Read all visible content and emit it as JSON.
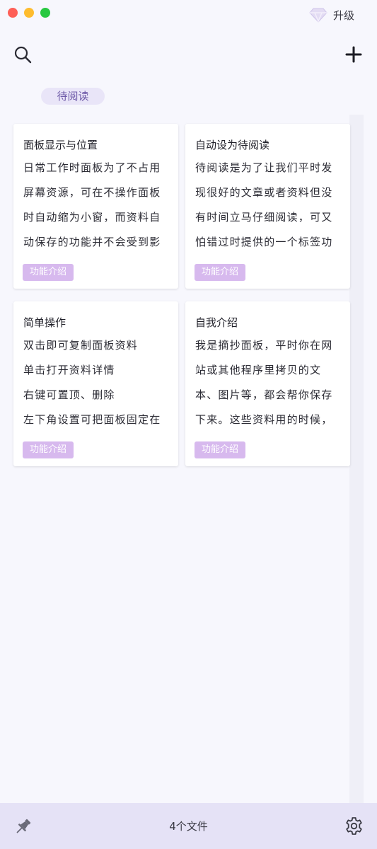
{
  "window": {
    "controls": [
      "close",
      "minimize",
      "zoom"
    ]
  },
  "header": {
    "upgrade": {
      "icon": "diamond-icon",
      "label": "升级"
    },
    "search_icon": "search-icon",
    "add_icon": "plus-icon",
    "tabs": [
      "",
      "",
      "",
      "",
      ""
    ]
  },
  "filter": {
    "active_label": "待阅读"
  },
  "cards": [
    {
      "title": "面板显示与位置",
      "lines": [
        "日常工作时面板为了不占用",
        "屏幕资源，可在不操作面板",
        "时自动缩为小窗，而资料自",
        "动保存的功能并不会受到影"
      ],
      "tag": "功能介绍"
    },
    {
      "title": "自动设为待阅读",
      "lines": [
        "待阅读是为了让我们平时发",
        "现很好的文章或者资料但没",
        "有时间立马仔细阅读，可又",
        "怕错过时提供的一个标签功"
      ],
      "tag": "功能介绍"
    },
    {
      "title": "简单操作",
      "lines": [
        "双击即可复制面板资料",
        "单击打开资料详情",
        "右键可置顶、删除",
        "左下角设置可把面板固定在"
      ],
      "tag": "功能介绍"
    },
    {
      "title": "自我介绍",
      "lines": [
        "我是摘抄面板，平时你在网",
        "站或其他程序里拷贝的文",
        "本、图片等，都会帮你保存",
        "下来。这些资料用的时候，"
      ],
      "tag": "功能介绍"
    }
  ],
  "footer": {
    "pin_icon": "pin-icon",
    "file_count": "4个文件",
    "settings_icon": "gear-icon"
  },
  "colors": {
    "background": "#f7f7fd",
    "accent_purple": "#d7b9ee",
    "chip_bg": "#e9e5f8",
    "footer_bg": "#e5e2f6"
  }
}
